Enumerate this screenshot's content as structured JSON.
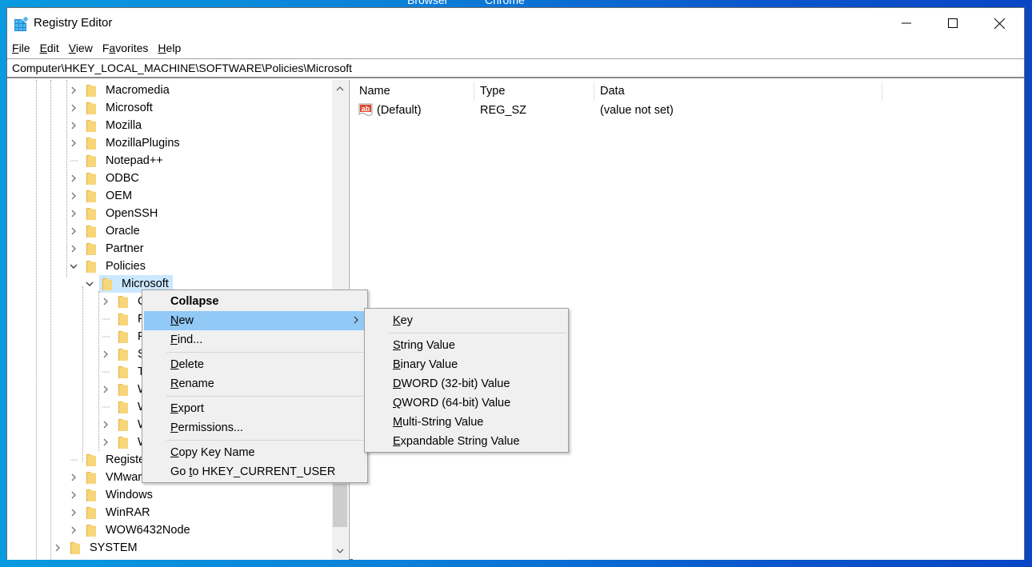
{
  "desktop": {
    "labels": [
      "Browser",
      "Chrome"
    ]
  },
  "window": {
    "title": "Registry Editor",
    "icon": "registry-editor-icon",
    "controls": {
      "minimize": "minimize-icon",
      "maximize": "maximize-icon",
      "close": "close-icon"
    }
  },
  "menubar": {
    "items": [
      {
        "label": "File",
        "accel": "F",
        "rest": "ile"
      },
      {
        "label": "Edit",
        "accel": "E",
        "rest": "dit"
      },
      {
        "label": "View",
        "accel": "V",
        "rest": "iew"
      },
      {
        "label": "Favorites",
        "pre": "F",
        "accel": "a",
        "rest": "vorites"
      },
      {
        "label": "Help",
        "accel": "H",
        "rest": "elp"
      }
    ]
  },
  "address": {
    "path": "Computer\\HKEY_LOCAL_MACHINE\\SOFTWARE\\Policies\\Microsoft"
  },
  "tree": {
    "items": [
      {
        "label": "Macromedia",
        "level": 3,
        "expander": "collapsed"
      },
      {
        "label": "Microsoft",
        "level": 3,
        "expander": "collapsed"
      },
      {
        "label": "Mozilla",
        "level": 3,
        "expander": "collapsed"
      },
      {
        "label": "MozillaPlugins",
        "level": 3,
        "expander": "collapsed"
      },
      {
        "label": "Notepad++",
        "level": 3,
        "expander": "none"
      },
      {
        "label": "ODBC",
        "level": 3,
        "expander": "collapsed"
      },
      {
        "label": "OEM",
        "level": 3,
        "expander": "collapsed"
      },
      {
        "label": "OpenSSH",
        "level": 3,
        "expander": "collapsed"
      },
      {
        "label": "Oracle",
        "level": 3,
        "expander": "collapsed"
      },
      {
        "label": "Partner",
        "level": 3,
        "expander": "collapsed"
      },
      {
        "label": "Policies",
        "level": 3,
        "expander": "expanded"
      },
      {
        "label": "Microsoft",
        "level": 4,
        "expander": "expanded",
        "selected": true
      },
      {
        "label": "Cry",
        "level": 5,
        "expander": "collapsed"
      },
      {
        "label": "Pee",
        "level": 5,
        "expander": "none"
      },
      {
        "label": "Pee",
        "level": 5,
        "expander": "none"
      },
      {
        "label": "Sys",
        "level": 5,
        "expander": "collapsed"
      },
      {
        "label": "TPI",
        "level": 5,
        "expander": "none"
      },
      {
        "label": "Wi",
        "level": 5,
        "expander": "collapsed"
      },
      {
        "label": "Wi",
        "level": 5,
        "expander": "none"
      },
      {
        "label": "Wi",
        "level": 5,
        "expander": "collapsed"
      },
      {
        "label": "Wi",
        "level": 5,
        "expander": "collapsed"
      },
      {
        "label": "Registere",
        "level": 3,
        "expander": "none"
      },
      {
        "label": "VMware,",
        "level": 3,
        "expander": "collapsed"
      },
      {
        "label": "Windows",
        "level": 3,
        "expander": "collapsed"
      },
      {
        "label": "WinRAR",
        "level": 3,
        "expander": "collapsed"
      },
      {
        "label": "WOW6432Node",
        "level": 3,
        "expander": "collapsed"
      },
      {
        "label": "SYSTEM",
        "level": 2,
        "expander": "collapsed"
      }
    ]
  },
  "values": {
    "columns": [
      "Name",
      "Type",
      "Data"
    ],
    "rows": [
      {
        "icon": "string-value-icon",
        "name": "(Default)",
        "type": "REG_SZ",
        "data": "(value not set)"
      }
    ]
  },
  "context_menu": {
    "items": [
      {
        "label": "Collapse",
        "bold": true
      },
      {
        "label": "New",
        "accel": "N",
        "rest": "ew",
        "submenu": true,
        "highlighted": true
      },
      {
        "label": "Find...",
        "accel": "F",
        "rest": "ind..."
      },
      {
        "separator": true
      },
      {
        "label": "Delete",
        "accel": "D",
        "rest": "elete"
      },
      {
        "label": "Rename",
        "accel": "R",
        "rest": "ename"
      },
      {
        "separator": true
      },
      {
        "label": "Export",
        "accel": "E",
        "rest": "xport"
      },
      {
        "label": "Permissions...",
        "accel": "P",
        "rest": "ermissions..."
      },
      {
        "separator": true
      },
      {
        "label": "Copy Key Name",
        "accel": "C",
        "rest": "opy Key Name"
      },
      {
        "label": "Go to HKEY_CURRENT_USER",
        "pre": "Go ",
        "accel": "t",
        "rest": "o HKEY_CURRENT_USER"
      }
    ]
  },
  "submenu": {
    "items": [
      {
        "label": "Key",
        "accel": "K",
        "rest": "ey"
      },
      {
        "separator": true
      },
      {
        "label": "String Value",
        "accel": "S",
        "rest": "tring Value"
      },
      {
        "label": "Binary Value",
        "accel": "B",
        "rest": "inary Value"
      },
      {
        "label": "DWORD (32-bit) Value",
        "accel": "D",
        "rest": "WORD (32-bit) Value"
      },
      {
        "label": "QWORD (64-bit) Value",
        "accel": "Q",
        "rest": "WORD (64-bit) Value"
      },
      {
        "label": "Multi-String Value",
        "accel": "M",
        "rest": "ulti-String Value"
      },
      {
        "label": "Expandable String Value",
        "accel": "E",
        "rest": "xpandable String Value"
      }
    ]
  },
  "colors": {
    "selection": "#cce8ff",
    "menu_highlight": "#91c9f7",
    "menu_bg": "#f0f0f0",
    "folder": "#f3c957"
  }
}
